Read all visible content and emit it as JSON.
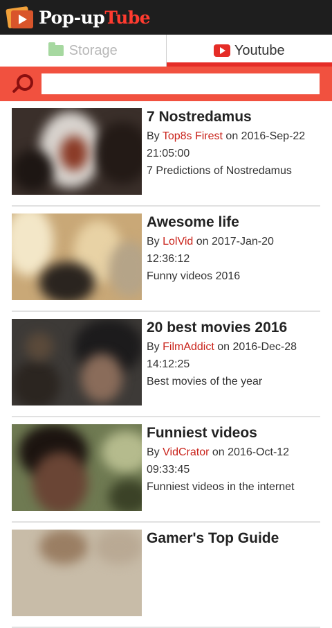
{
  "app": {
    "title_part1": "Pop-up",
    "title_part2": "Tube"
  },
  "tabs": [
    {
      "label": "Storage",
      "icon": "folder-icon",
      "active": false
    },
    {
      "label": "Youtube",
      "icon": "youtube-icon",
      "active": true
    }
  ],
  "search": {
    "value": "",
    "placeholder": ""
  },
  "colors": {
    "accent": "#f1513f",
    "author": "#c9231b",
    "appbar": "#1e1e1e"
  },
  "videos": [
    {
      "title": "7 Nostredamus",
      "by_label": "By",
      "author": "Top8s Firest",
      "on_label": "on",
      "date": "2016-Sep-22",
      "time": "21:05:00",
      "description": "7 Predictions of Nostredamus"
    },
    {
      "title": "Awesome life",
      "by_label": "By",
      "author": "LolVid",
      "on_label": "on",
      "date": "2017-Jan-20",
      "time": "12:36:12",
      "description": "Funny videos 2016"
    },
    {
      "title": "20 best movies 2016",
      "by_label": "By",
      "author": "FilmAddict",
      "on_label": "on",
      "date": "2016-Dec-28",
      "time": "14:12:25",
      "description": "Best movies of the year"
    },
    {
      "title": "Funniest videos",
      "by_label": "By",
      "author": "VidCrator",
      "on_label": "on",
      "date": "2016-Oct-12",
      "time": "09:33:45",
      "description": "Funniest videos in the internet"
    },
    {
      "title": "Gamer's Top Guide",
      "by_label": "",
      "author": "",
      "on_label": "",
      "date": "",
      "time": "",
      "description": ""
    }
  ]
}
